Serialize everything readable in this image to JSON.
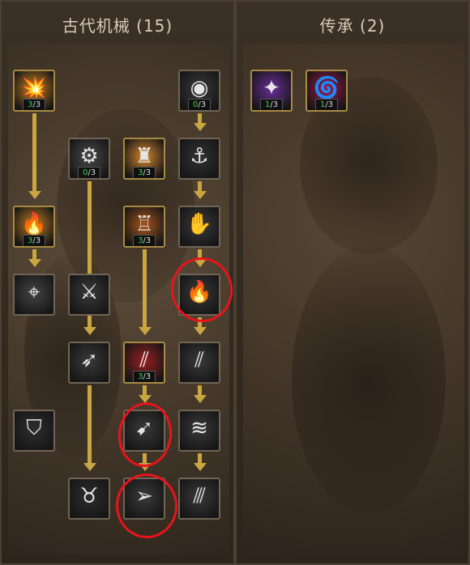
{
  "left_panel": {
    "title": "古代机械 (15)"
  },
  "right_panel": {
    "title": "传承 (2)"
  },
  "colors": {
    "connector": "#c9a640",
    "points_current": "#3fcf56",
    "annotation": "#e8141c"
  },
  "left_nodes": [
    {
      "id": "burst-strike",
      "icon": "exploding-bullet-icon",
      "glyph": "💥",
      "bg": "#c9861f",
      "cur": "3",
      "max": "/3",
      "learned": true
    },
    {
      "id": "dark-orb",
      "icon": "dark-orb-icon",
      "glyph": "◉",
      "bg": "#3a3a3a",
      "cur": "0",
      "max": "/3",
      "learned": false
    },
    {
      "id": "gear-ring",
      "icon": "gear-ring-icon",
      "glyph": "⚙",
      "bg": "#4a4a4a",
      "cur": "0",
      "max": "/3",
      "learned": false
    },
    {
      "id": "shadow-figure",
      "icon": "silhouette-figure-icon",
      "glyph": "♜",
      "bg": "#d9882e",
      "cur": "3",
      "max": "/3",
      "learned": true
    },
    {
      "id": "hook",
      "icon": "hook-icon",
      "glyph": "⚓",
      "bg": "#333333",
      "cur": "",
      "max": "",
      "learned": false
    },
    {
      "id": "piercing-round",
      "icon": "flaming-bullet-icon",
      "glyph": "🔥",
      "bg": "#c07d22",
      "cur": "3",
      "max": "/3",
      "learned": true
    },
    {
      "id": "tower",
      "icon": "tower-silhouette-icon",
      "glyph": "♖",
      "bg": "#a8561d",
      "cur": "3",
      "max": "/3",
      "learned": true
    },
    {
      "id": "grasp",
      "icon": "grasping-hand-icon",
      "glyph": "✋",
      "bg": "#3b3b3b",
      "cur": "",
      "max": "",
      "learned": false
    },
    {
      "id": "target-sight",
      "icon": "crosshair-icon",
      "glyph": "⌖",
      "bg": "#444444",
      "cur": "",
      "max": "",
      "learned": false
    },
    {
      "id": "crossed-swords",
      "icon": "crossed-swords-icon",
      "glyph": "⚔",
      "bg": "#3a3a3a",
      "cur": "",
      "max": "",
      "learned": false
    },
    {
      "id": "fire-claw",
      "icon": "flame-claw-icon",
      "glyph": "🔥",
      "bg": "#3a3a3a",
      "cur": "",
      "max": "",
      "learned": false
    },
    {
      "id": "spear-throw",
      "icon": "spear-icon",
      "glyph": "➶",
      "bg": "#3a3a3a",
      "cur": "",
      "max": "",
      "learned": false
    },
    {
      "id": "triple-spears",
      "icon": "red-spears-icon",
      "glyph": "⫽",
      "bg": "#9c1f1f",
      "cur": "3",
      "max": "/3",
      "learned": true
    },
    {
      "id": "slash-a",
      "icon": "slash-icon",
      "glyph": "⫽",
      "bg": "#3a3a3a",
      "cur": "",
      "max": "",
      "learned": false
    },
    {
      "id": "shield",
      "icon": "shield-icon",
      "glyph": "⛉",
      "bg": "#2e2e2e",
      "cur": "",
      "max": "",
      "learned": false
    },
    {
      "id": "spear-rush",
      "icon": "spear-burst-icon",
      "glyph": "➹",
      "bg": "#3a3a3a",
      "cur": "",
      "max": "",
      "learned": false
    },
    {
      "id": "slash-b",
      "icon": "slash-wave-icon",
      "glyph": "≋",
      "bg": "#3a3a3a",
      "cur": "",
      "max": "",
      "learned": false
    },
    {
      "id": "bull-guard",
      "icon": "horned-warrior-icon",
      "glyph": "♉",
      "bg": "#2e2e2e",
      "cur": "",
      "max": "",
      "learned": false
    },
    {
      "id": "arrow-shot",
      "icon": "arrow-icon",
      "glyph": "➢",
      "bg": "#3a3a3a",
      "cur": "",
      "max": "",
      "learned": false
    },
    {
      "id": "slash-c",
      "icon": "triple-slash-icon",
      "glyph": "⫻",
      "bg": "#3a3a3a",
      "cur": "",
      "max": "",
      "learned": false
    }
  ],
  "right_nodes": [
    {
      "id": "violet-shards",
      "icon": "violet-crystal-icon",
      "glyph": "✦",
      "bg": "#6b2d9c",
      "cur": "1",
      "max": "/3",
      "learned": true
    },
    {
      "id": "crimson-vortex",
      "icon": "crimson-vortex-icon",
      "glyph": "🌀",
      "bg": "#a3174c",
      "cur": "1",
      "max": "/3",
      "learned": true
    }
  ]
}
